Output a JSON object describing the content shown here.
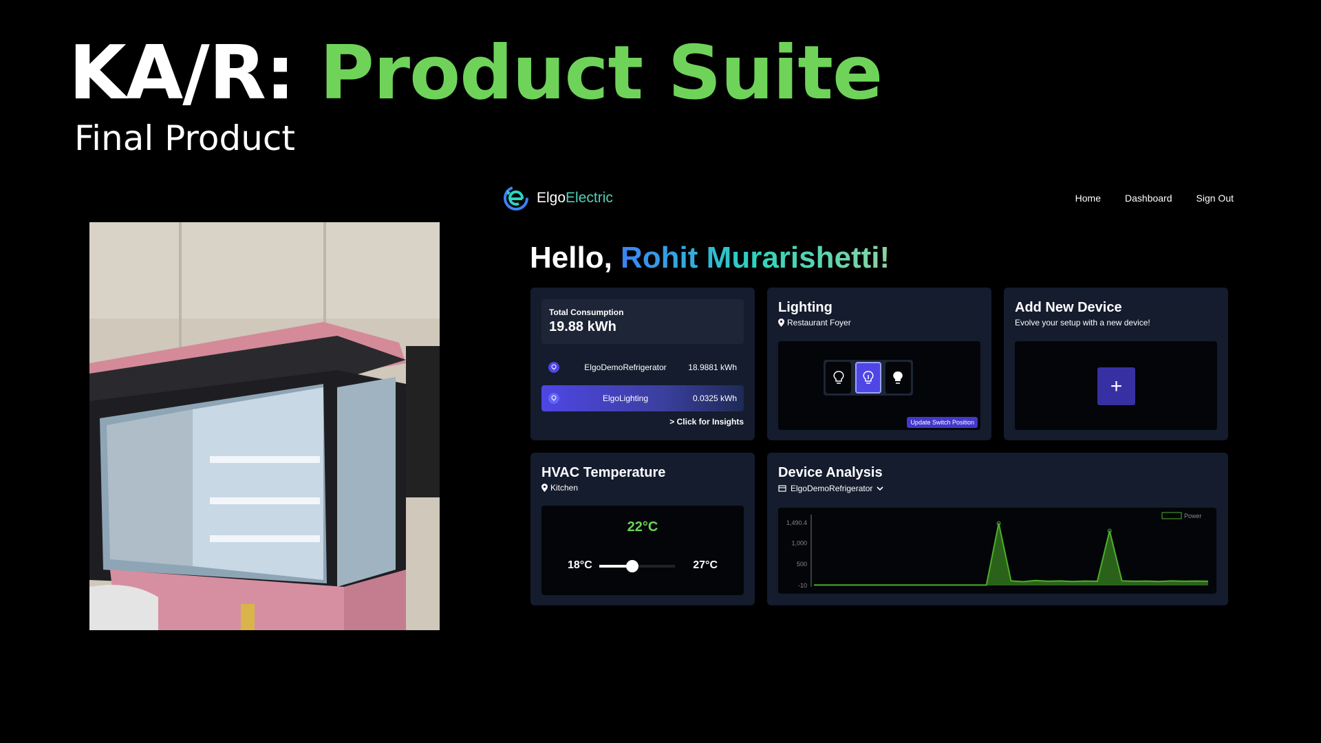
{
  "slide": {
    "title_prefix": "KA/R:",
    "title_accent": "Product Suite",
    "subtitle": "Final Product"
  },
  "app": {
    "brand_part1": "Elgo",
    "brand_part2": "Electric",
    "nav": [
      "Home",
      "Dashboard",
      "Sign Out"
    ],
    "greeting": "Hello,",
    "user_name": "Rohit Murarishetti!"
  },
  "consumption": {
    "label": "Total Consumption",
    "value": "19.88 kWh",
    "devices": [
      {
        "name": "ElgoDemoRefrigerator",
        "usage": "18.9881 kWh"
      },
      {
        "name": "ElgoLighting",
        "usage": "0.0325 kWh"
      }
    ],
    "insights": "> Click for Insights"
  },
  "lighting": {
    "title": "Lighting",
    "location": "Restaurant Foyer",
    "update_label": "Update Switch Position"
  },
  "add_device": {
    "title": "Add New Device",
    "subtitle": "Evolve your setup with a new device!",
    "plus": "+"
  },
  "hvac": {
    "title": "HVAC Temperature",
    "location": "Kitchen",
    "current": "22°C",
    "min": "18°C",
    "max": "27°C",
    "level_fraction": 0.44
  },
  "analysis": {
    "title": "Device Analysis",
    "selected_device": "ElgoDemoRefrigerator"
  },
  "chart_data": {
    "type": "line",
    "series": [
      {
        "name": "Power",
        "x": [
          0,
          1,
          2,
          3,
          4,
          5,
          6,
          7,
          8,
          9,
          10,
          11,
          12,
          13,
          14,
          15,
          16,
          17,
          18,
          19,
          20,
          21,
          22,
          23,
          24,
          25,
          26,
          27,
          28,
          29,
          30,
          31,
          32
        ],
        "y": [
          0,
          0,
          0,
          0,
          0,
          0,
          0,
          0,
          0,
          0,
          0,
          0,
          0,
          0,
          0,
          1480,
          100,
          80,
          110,
          90,
          100,
          85,
          95,
          90,
          1300,
          100,
          90,
          95,
          85,
          100,
          90,
          95,
          90
        ]
      }
    ],
    "yticks": [
      "1,490.4",
      "1,000",
      "500",
      "-10"
    ],
    "ylim": [
      -10,
      1490.4
    ],
    "legend_position": "top-right",
    "grid": false,
    "color": "#4caf2a"
  },
  "colors": {
    "accent_green": "#6fd35a",
    "card_bg": "#141c2e",
    "indigo": "#4f46e5"
  }
}
